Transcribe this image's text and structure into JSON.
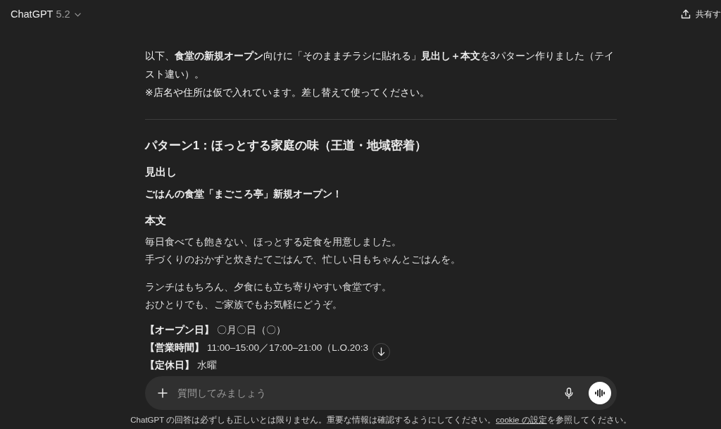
{
  "header": {
    "title": "ChatGPT",
    "version": "5.2",
    "share_label": "共有す"
  },
  "message": {
    "intro": "以下、**食堂の新規オープン**向けに「そのままチラシに貼れる」**見出し＋本文**を3パターン作りました（テイスト違い）。",
    "note": "※店名や住所は仮で入れています。差し替えて使ってください。",
    "section_title": "パターン1：ほっとする家庭の味（王道・地域密着）",
    "blocks": [
      {
        "kind": "heading",
        "text": "見出し"
      },
      {
        "kind": "bold_line",
        "text": "ごはんの食堂「まごころ亭」新規オープン！"
      },
      {
        "kind": "heading",
        "text": "本文"
      },
      {
        "kind": "paragraph",
        "lines": [
          "毎日食べても飽きない、ほっとする定食を用意しました。",
          "手づくりのおかずと炊きたてごはんで、忙しい日もちゃんとごはんを。"
        ]
      },
      {
        "kind": "paragraph",
        "lines": [
          "ランチはもちろん、夕食にも立ち寄りやすい食堂です。",
          "おひとりでも、ご家族でもお気軽にどうぞ。"
        ]
      },
      {
        "kind": "details",
        "rows": [
          {
            "label": "【オープン日】",
            "value": "〇月〇日（〇）"
          },
          {
            "label": "【営業時間】",
            "value": "11:00–15:00／17:00–21:00（L.O.20:3"
          },
          {
            "label": "【定休日】",
            "value": "水曜"
          }
        ]
      }
    ]
  },
  "composer": {
    "placeholder": "質問してみましょう"
  },
  "footer": {
    "text": "ChatGPT の回答は必ずしも正しいとは限りません。重要な情報は確認するようにしてください。",
    "link": "cookie の設定",
    "text_after": "を参照してください。"
  }
}
